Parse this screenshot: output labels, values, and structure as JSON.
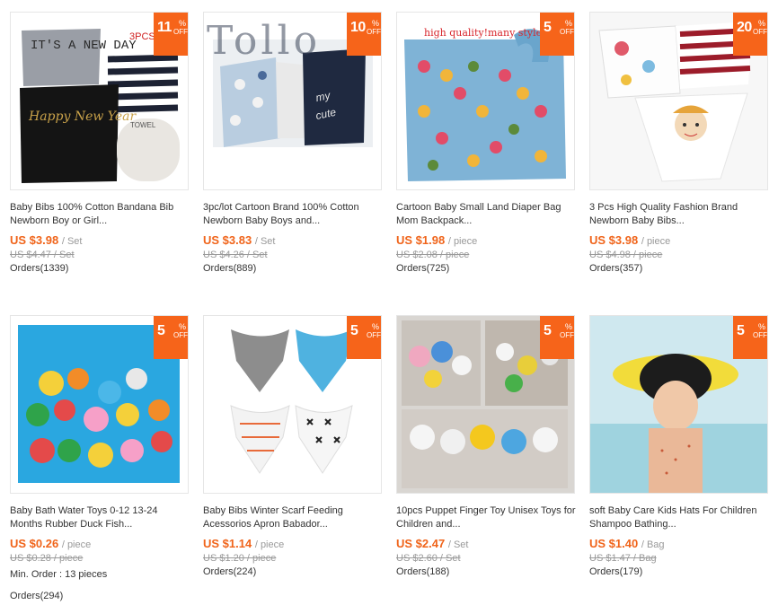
{
  "colors": {
    "accent": "#f0641a",
    "badge": "#f6641a",
    "muted": "#999999",
    "text": "#333333"
  },
  "watermark": "Tollo",
  "products": [
    {
      "image_caption": "3PCS/SET",
      "image_caption_2": "IT'S A NEW DAY",
      "image_caption_3": "Happy New Year",
      "image_caption_4": "TOWEL",
      "discount": "11",
      "pct": "%",
      "off": "OFF",
      "title": "Baby Bibs 100% Cotton Bandana Bib Newborn Boy or Girl...",
      "price": "US $3.98",
      "unit": "/ Set",
      "old_price": "US $4.47 / Set",
      "min_order": "",
      "orders": "Orders(1339)"
    },
    {
      "image_caption": "",
      "discount": "10",
      "pct": "%",
      "off": "OFF",
      "title": "3pc/lot Cartoon Brand 100% Cotton Newborn Baby Boys and...",
      "price": "US $3.83",
      "unit": "/ Set",
      "old_price": "US $4.26 / Set",
      "min_order": "",
      "orders": "Orders(889)"
    },
    {
      "image_caption": "high quality!many styles",
      "discount": "5",
      "pct": "%",
      "off": "OFF",
      "title": "Cartoon Baby Small Land Diaper Bag Mom Backpack...",
      "price": "US $1.98",
      "unit": "/ piece",
      "old_price": "US $2.08 / piece",
      "min_order": "",
      "orders": "Orders(725)"
    },
    {
      "image_caption": "",
      "discount": "20",
      "pct": "%",
      "off": "OFF",
      "title": "3 Pcs High Quality Fashion Brand Newborn Baby Bibs...",
      "price": "US $3.98",
      "unit": "/ piece",
      "old_price": "US $4.98 / piece",
      "min_order": "",
      "orders": "Orders(357)"
    },
    {
      "image_caption": "",
      "discount": "5",
      "pct": "%",
      "off": "OFF",
      "title": "Baby Bath Water Toys 0-12 13-24 Months Rubber Duck Fish...",
      "price": "US $0.26",
      "unit": "/ piece",
      "old_price": "US $0.28 / piece",
      "min_order": "Min. Order : 13 pieces",
      "orders": "Orders(294)"
    },
    {
      "image_caption": "",
      "discount": "5",
      "pct": "%",
      "off": "OFF",
      "title": "Baby Bibs Winter Scarf Feeding Acessorios Apron Babador...",
      "price": "US $1.14",
      "unit": "/ piece",
      "old_price": "US $1.20 / piece",
      "min_order": "",
      "orders": "Orders(224)"
    },
    {
      "image_caption": "",
      "discount": "5",
      "pct": "%",
      "off": "OFF",
      "title": "10pcs Puppet Finger Toy Unisex Toys for Children and...",
      "price": "US $2.47",
      "unit": "/ Set",
      "old_price": "US $2.60 / Set",
      "min_order": "",
      "orders": "Orders(188)"
    },
    {
      "image_caption": "",
      "discount": "5",
      "pct": "%",
      "off": "OFF",
      "title": "soft Baby Care Kids Hats For Children Shampoo Bathing...",
      "price": "US $1.40",
      "unit": "/ Bag",
      "old_price": "US $1.47 / Bag",
      "min_order": "",
      "orders": "Orders(179)"
    }
  ]
}
